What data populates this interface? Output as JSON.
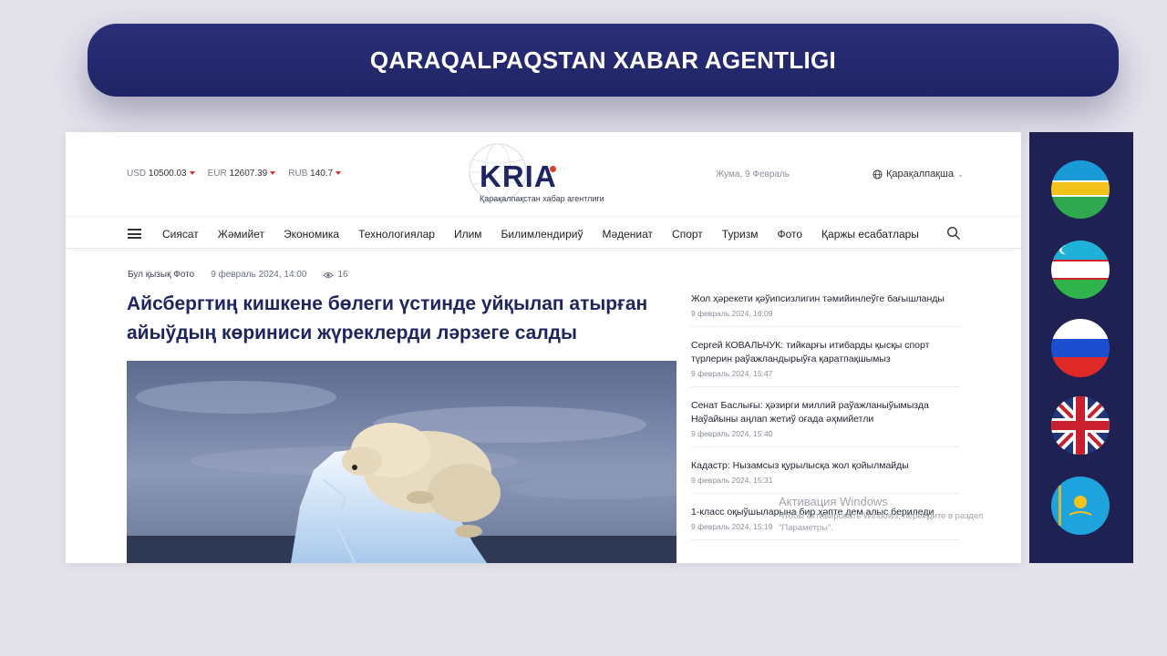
{
  "banner": {
    "title": "QARAQALPAQSTAN XABAR AGENTLIGI"
  },
  "header": {
    "currencies": [
      {
        "code": "USD",
        "value": "10500.03"
      },
      {
        "code": "EUR",
        "value": "12607.39"
      },
      {
        "code": "RUB",
        "value": "140.7"
      }
    ],
    "logo_text": "KRIA",
    "logo_subtitle": "Қарақалпақстан хабар агентлиги",
    "date": "Жума, 9 Февраль",
    "language": "Қарақалпақша"
  },
  "nav": {
    "items": [
      "Сиясат",
      "Жәмийет",
      "Экономика",
      "Технологиялар",
      "Илим",
      "Билимлендириў",
      "Мәдениат",
      "Спорт",
      "Туризм",
      "Фото",
      "Қаржы есабатлары"
    ]
  },
  "article": {
    "category": "Бул қызық Фото",
    "date": "9 февраль 2024, 14:00",
    "views": "16",
    "title": "Айсбергтиң кишкене бөлеги үстинде уйқылап атырған айыўдың көриниси жүреклерди ләрзеге салды"
  },
  "sidebar_news": [
    {
      "title": "Жол ҳәрекети қәўипсизлигин тәмийинлеўге бағышланды",
      "time": "9 февраль 2024, 16:09"
    },
    {
      "title": "Сергей КОВАЛЬЧУК: тийкарғы итибарды қысқы спорт түрлерин раўажландырыўға қаратпақшымыз",
      "time": "9 февраль 2024, 15:47"
    },
    {
      "title": "Сенат Баслығы: ҳәзирги миллий раўажланыўымызда Наўайыны аңлап жетиў оғада әҳмийетли",
      "time": "9 февраль 2024, 15:40"
    },
    {
      "title": "Кадастр:  Нызамсыз қурылысқа жол қойылмайды",
      "time": "9 февраль 2024, 15:31"
    },
    {
      "title": "1-класс оқыўшыларына бир ҳәпте дем алыс бериледи",
      "time": "9 февраль 2024, 15:19"
    }
  ],
  "watermark": {
    "title": "Активация Windows",
    "text": "Чтобы активировать Windows, перейдите в раздел \"Параметры\"."
  },
  "flags": [
    {
      "name": "karakalpakstan-flag",
      "colors": [
        "#1a9ad6",
        "#f2c21b",
        "#ffffff",
        "#2fa84f"
      ]
    },
    {
      "name": "uzbekistan-flag",
      "colors": [
        "#1eb2d9",
        "#ffffff",
        "#d2232a",
        "#2fb34a"
      ]
    },
    {
      "name": "russia-flag",
      "colors": [
        "#ffffff",
        "#1b4fcf",
        "#e02a2a"
      ]
    },
    {
      "name": "uk-flag",
      "colors": [
        "#23357a",
        "#ffffff",
        "#c8202f"
      ]
    },
    {
      "name": "kazakhstan-flag",
      "colors": [
        "#1ea3dd",
        "#f5c21b"
      ]
    }
  ]
}
